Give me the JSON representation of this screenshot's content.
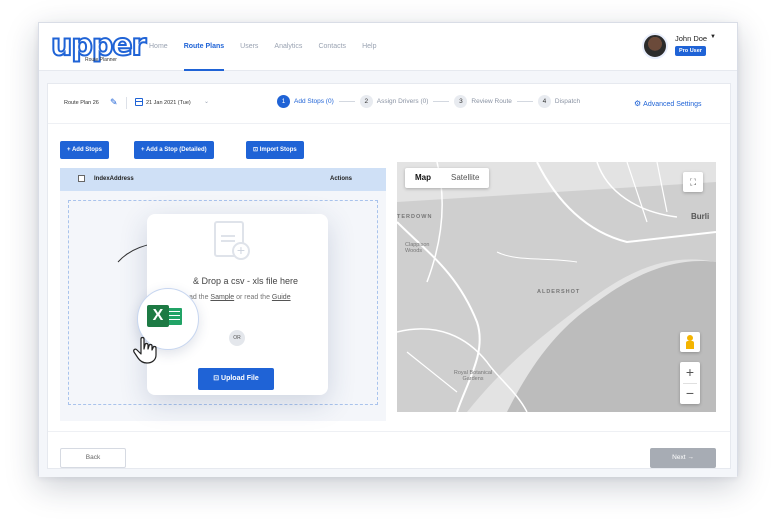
{
  "brand": {
    "logo_text": "upper",
    "logo_sub": "Route Planner",
    "color": "#1f63d6"
  },
  "nav": {
    "items": [
      {
        "label": "Home"
      },
      {
        "label": "Route Plans"
      },
      {
        "label": "Users"
      },
      {
        "label": "Analytics"
      },
      {
        "label": "Contacts"
      },
      {
        "label": "Help"
      }
    ],
    "active": "Route Plans"
  },
  "user": {
    "name": "John Doe",
    "caret": "▼",
    "badge": "Pro User"
  },
  "plan": {
    "name": "Route Plan 26",
    "date": "21 Jan 2021 (Tue)"
  },
  "steps": [
    {
      "num": "1",
      "label": "Add Stops (0)"
    },
    {
      "num": "2",
      "label": "Assign Drivers (0)"
    },
    {
      "num": "3",
      "label": "Review Route"
    },
    {
      "num": "4",
      "label": "Dispatch"
    }
  ],
  "advanced_settings": "Advanced Settings",
  "actions": {
    "add_stops": "+ Add Stops",
    "add_stop_detailed": "+ Add a Stop (Detailed)",
    "import_stops": "Import Stops"
  },
  "table": {
    "col_index_address": "IndexAddress",
    "col_actions": "Actions"
  },
  "upload": {
    "drop_text": "& Drop a csv - xls file here",
    "sub_prefix": "ad the ",
    "sample_link": "Sample",
    "sub_mid": " or read the ",
    "guide_link": "Guide",
    "or": "OR",
    "button": "Upload File"
  },
  "map": {
    "tabs": [
      "Map",
      "Satellite"
    ],
    "labels": [
      "ALDERSHOT",
      "TERDOWN",
      "Burli",
      "Clappison Woods",
      "Royal Botanical Gardens"
    ],
    "zoom_in": "+",
    "zoom_out": "−"
  },
  "footer": {
    "back": "Back",
    "next": "Next →"
  },
  "icons": {
    "edit": "edit-icon",
    "calendar": "calendar-icon",
    "gear": "gear-icon",
    "excel": "excel-icon",
    "hand": "hand-pointer-icon",
    "file": "file-plus-icon",
    "fullscreen": "fullscreen-icon",
    "pegman": "street-view-icon"
  }
}
